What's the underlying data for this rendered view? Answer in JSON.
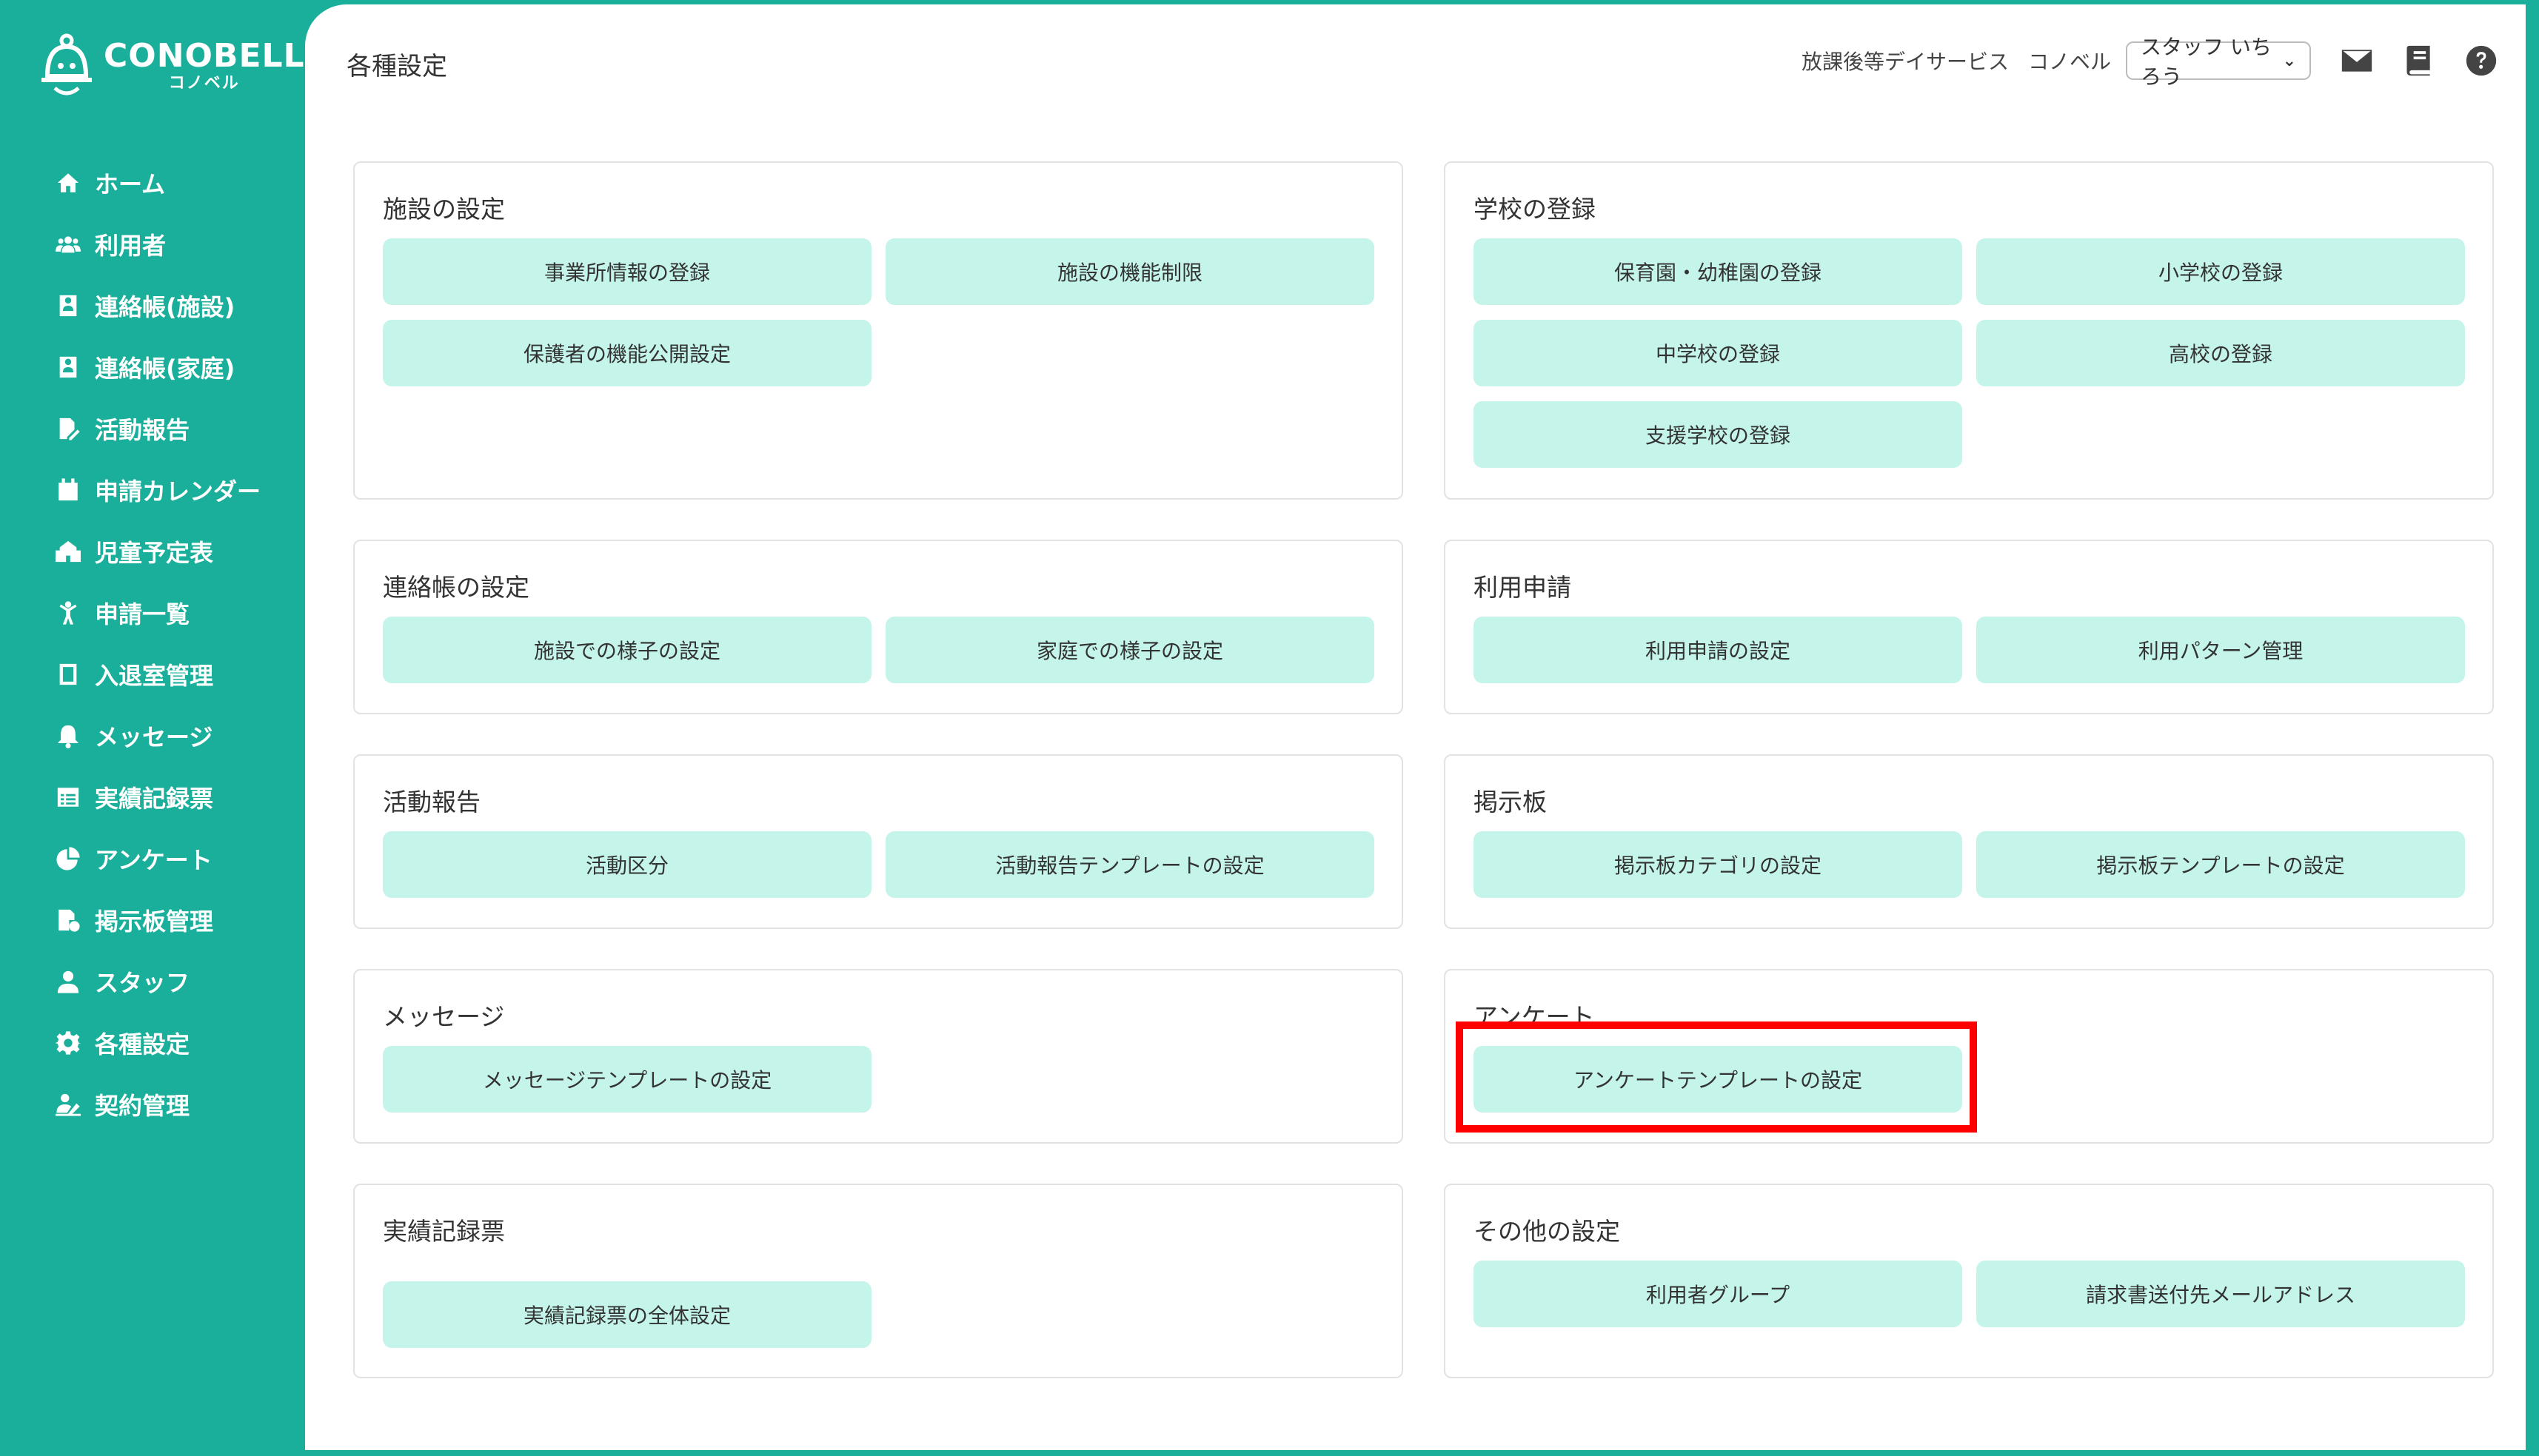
{
  "app": {
    "logo_main": "CONOBELL",
    "logo_sub": "コノベル"
  },
  "sidebar": {
    "items": [
      {
        "label": "ホーム",
        "icon": "home-icon"
      },
      {
        "label": "利用者",
        "icon": "users-icon"
      },
      {
        "label": "連絡帳(施設)",
        "icon": "contact-book-icon"
      },
      {
        "label": "連絡帳(家庭)",
        "icon": "contact-book-icon"
      },
      {
        "label": "活動報告",
        "icon": "report-edit-icon"
      },
      {
        "label": "申請カレンダー",
        "icon": "calendar-icon"
      },
      {
        "label": "児童予定表",
        "icon": "school-icon"
      },
      {
        "label": "申請一覧",
        "icon": "child-icon"
      },
      {
        "label": "入退室管理",
        "icon": "door-icon"
      },
      {
        "label": "メッセージ",
        "icon": "bell-icon"
      },
      {
        "label": "実績記録票",
        "icon": "table-icon"
      },
      {
        "label": "アンケート",
        "icon": "pie-chart-icon"
      },
      {
        "label": "掲示板管理",
        "icon": "board-icon"
      },
      {
        "label": "スタッフ",
        "icon": "staff-icon"
      },
      {
        "label": "各種設定",
        "icon": "gear-icon"
      },
      {
        "label": "契約管理",
        "icon": "contract-icon"
      }
    ]
  },
  "header": {
    "page_title": "各種設定",
    "service": "放課後等デイサービス",
    "org": "コノベル",
    "staff_select": "スタッフ いちろう",
    "icons": [
      "mail-icon",
      "book-icon",
      "help-icon"
    ]
  },
  "sections": {
    "facility": {
      "title": "施設の設定",
      "buttons": [
        "事業所情報の登録",
        "施設の機能制限",
        "保護者の機能公開設定"
      ]
    },
    "school": {
      "title": "学校の登録",
      "buttons": [
        "保育園・幼稚園の登録",
        "小学校の登録",
        "中学校の登録",
        "高校の登録",
        "支援学校の登録"
      ]
    },
    "contact": {
      "title": "連絡帳の設定",
      "buttons": [
        "施設での様子の設定",
        "家庭での様子の設定"
      ]
    },
    "application": {
      "title": "利用申請",
      "buttons": [
        "利用申請の設定",
        "利用パターン管理"
      ]
    },
    "activity": {
      "title": "活動報告",
      "buttons": [
        "活動区分",
        "活動報告テンプレートの設定"
      ]
    },
    "board": {
      "title": "掲示板",
      "buttons": [
        "掲示板カテゴリの設定",
        "掲示板テンプレートの設定"
      ]
    },
    "message": {
      "title": "メッセージ",
      "buttons": [
        "メッセージテンプレートの設定"
      ]
    },
    "survey": {
      "title": "アンケート",
      "buttons": [
        "アンケートテンプレートの設定"
      ]
    },
    "records": {
      "title": "実績記録票",
      "buttons": [
        "実績記録票の全体設定"
      ]
    },
    "other": {
      "title": "その他の設定",
      "buttons": [
        "利用者グループ",
        "請求書送付先メールアドレス"
      ]
    }
  },
  "colors": {
    "brand": "#1aaf9a",
    "button_bg": "#c5f5ea",
    "highlight": "#ff0000"
  }
}
